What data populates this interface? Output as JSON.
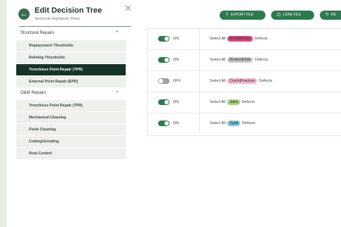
{
  "sidebar": {
    "title": "Edit Decision Tree",
    "subtitle": "Seminole Highlands Pines",
    "back_icon": "arrow-left-icon",
    "close_icon": "close-icon",
    "sections": [
      {
        "label": "Structural Repairs",
        "expanded": true,
        "items": [
          {
            "label": "Replacement Thresholds",
            "active": false
          },
          {
            "label": "Relining Thresholds",
            "active": false
          },
          {
            "label": "Trenchless Point Repair (TPR)",
            "active": true
          },
          {
            "label": "External Point Repair (EPR)",
            "active": false
          }
        ]
      },
      {
        "label": "O&M Repairs",
        "expanded": true,
        "items": [
          {
            "label": "Trenchless Point Repair (TPR)",
            "active": false
          },
          {
            "label": "Mechanical Cleaning",
            "active": false
          },
          {
            "label": "Flush Cleaning",
            "active": false
          },
          {
            "label": "Cutting/Grinding",
            "active": false
          },
          {
            "label": "Root Control",
            "active": false
          }
        ]
      }
    ]
  },
  "toolbar": {
    "export_label": "EXPORT FILE",
    "load_label": "LOAD FILE",
    "reset_label": "RE"
  },
  "rows": [
    {
      "state": "ON",
      "enabled": true,
      "prefix": "Select All",
      "tag": "Brick|Mortar",
      "tag_color": "#e0457b",
      "suffix": "Defects"
    },
    {
      "state": "ON",
      "enabled": true,
      "prefix": "Select All",
      "tag": "Broken|Hole",
      "tag_color": "#c9c9c9",
      "suffix": "Defects"
    },
    {
      "state": "OFF",
      "enabled": false,
      "prefix": "Select All",
      "tag": "Crack|Fracture",
      "tag_color": "#f4b6cb",
      "suffix": "Defects"
    },
    {
      "state": "ON",
      "enabled": true,
      "prefix": "Select All",
      "tag": "Joint",
      "tag_color": "#a3d17c",
      "suffix": "Defects"
    },
    {
      "state": "ON",
      "enabled": true,
      "prefix": "Select All",
      "tag": "Spall",
      "tag_color": "#7cc6dd",
      "suffix": "Defects"
    }
  ],
  "colors": {
    "accent": "#2c7a4d",
    "active_item": "#17342a"
  }
}
